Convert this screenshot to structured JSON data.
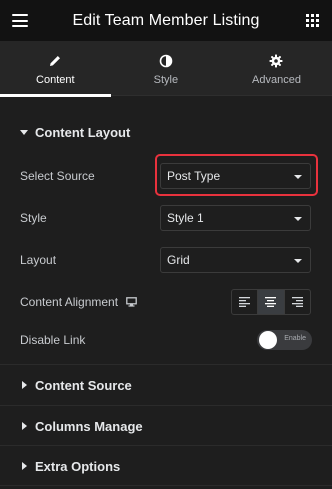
{
  "header": {
    "title": "Edit Team Member Listing"
  },
  "tabs": [
    {
      "label": "Content",
      "icon": "pencil-icon"
    },
    {
      "label": "Style",
      "icon": "half-circle-icon"
    },
    {
      "label": "Advanced",
      "icon": "gear-icon"
    }
  ],
  "content_layout": {
    "title": "Content Layout",
    "select_source": {
      "label": "Select Source",
      "value": "Post Type"
    },
    "style": {
      "label": "Style",
      "value": "Style 1"
    },
    "layout": {
      "label": "Layout",
      "value": "Grid"
    },
    "alignment": {
      "label": "Content Alignment",
      "selected": "center"
    },
    "disable_link": {
      "label": "Disable Link",
      "state_label": "Enable"
    }
  },
  "sections": [
    {
      "title": "Content Source"
    },
    {
      "title": "Columns Manage"
    },
    {
      "title": "Extra Options"
    }
  ],
  "colors": {
    "accent_highlight": "#e9323d",
    "background": "#1e1e1e",
    "header": "#121212"
  }
}
